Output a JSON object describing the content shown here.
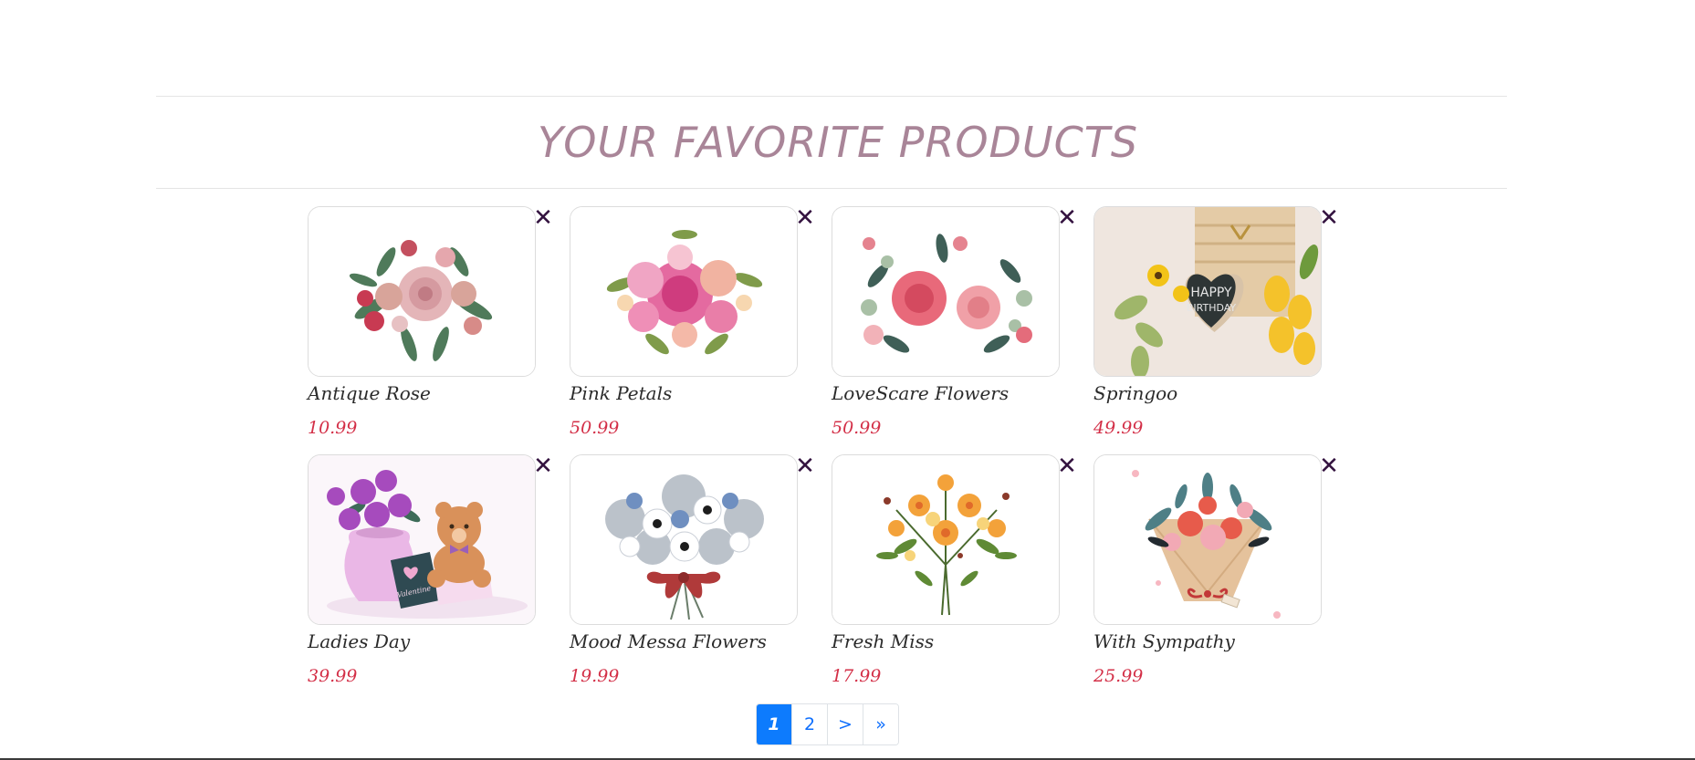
{
  "header": {
    "title": "YOUR FAVORITE PRODUCTS"
  },
  "products": [
    {
      "name": "Antique Rose",
      "price": "10.99",
      "remove_icon": "close-icon",
      "image": "rose-bouquet"
    },
    {
      "name": "Pink Petals",
      "price": "50.99",
      "remove_icon": "close-icon",
      "image": "pink-dahlia-bouquet"
    },
    {
      "name": "LoveScare Flowers",
      "price": "50.99",
      "remove_icon": "close-icon",
      "image": "pink-roses"
    },
    {
      "name": "Springoo",
      "price": "49.99",
      "remove_icon": "close-icon",
      "image": "birthday-tulips"
    },
    {
      "name": "Ladies Day",
      "price": "39.99",
      "remove_icon": "close-icon",
      "image": "purple-roses-teddy-bear"
    },
    {
      "name": "Mood Messa Flowers",
      "price": "19.99",
      "remove_icon": "close-icon",
      "image": "blue-white-bouquet"
    },
    {
      "name": "Fresh Miss",
      "price": "17.99",
      "remove_icon": "close-icon",
      "image": "orange-wildflowers"
    },
    {
      "name": "With Sympathy",
      "price": "25.99",
      "remove_icon": "close-icon",
      "image": "wrapped-bouquet"
    }
  ],
  "image_lettering": {
    "birthday_sign": "HAPPY BIRTHDAY",
    "card_text": "Valentine"
  },
  "pagination": {
    "items": [
      {
        "label": "1",
        "active": true
      },
      {
        "label": "2",
        "active": false
      },
      {
        "label": ">",
        "active": false
      },
      {
        "label": "»",
        "active": false
      }
    ]
  },
  "colors": {
    "title": "#a98598",
    "price": "#d32f47",
    "close_icon": "#33123f",
    "pagination_active": "#0d7bfd",
    "pagination_link": "#0d6efd"
  }
}
